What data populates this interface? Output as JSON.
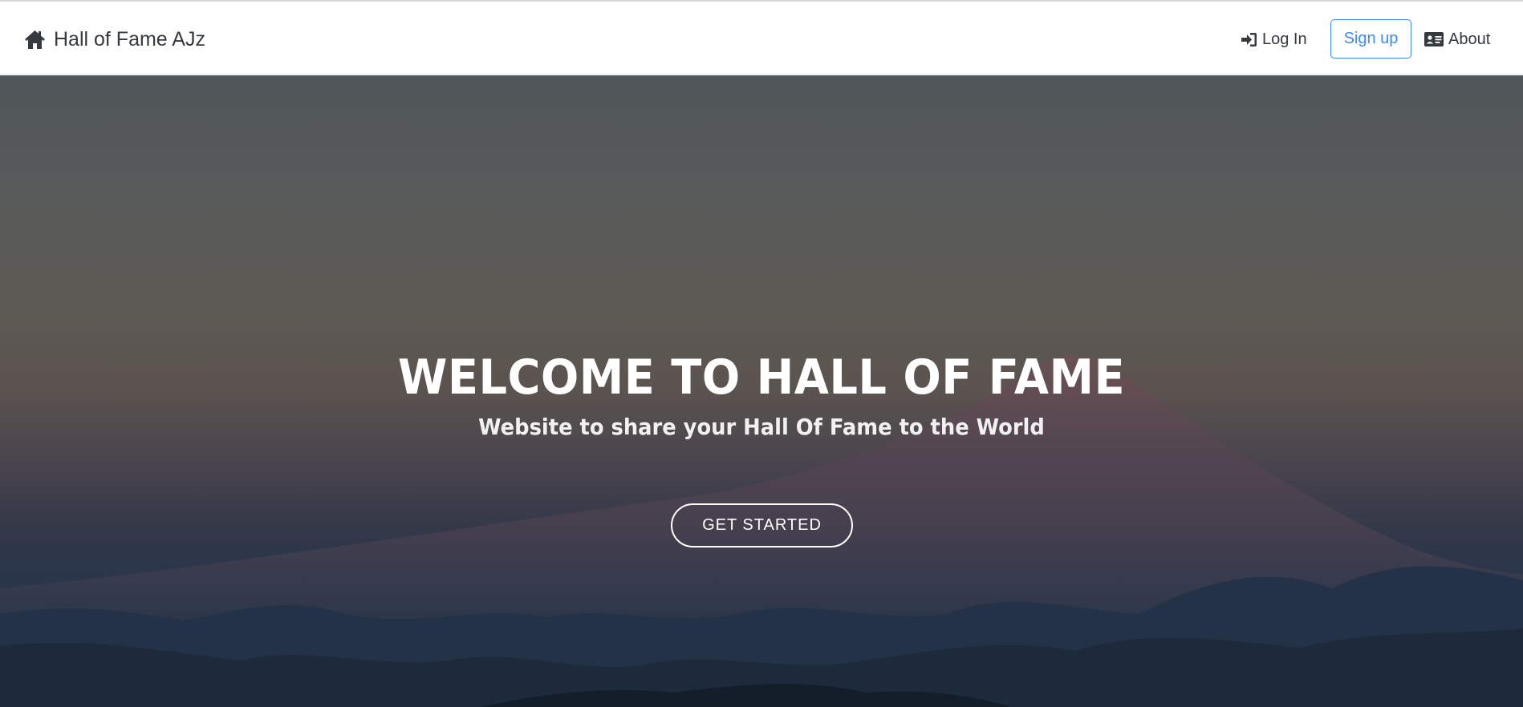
{
  "navbar": {
    "brand_label": "Hall of Fame AJz",
    "brand_icon": "home-icon",
    "login_label": "Log In",
    "login_icon": "sign-in-icon",
    "signup_label": "Sign up",
    "about_label": "About",
    "about_icon": "id-card-icon"
  },
  "hero": {
    "title": "WELCOME TO HALL OF FAME",
    "subtitle": "Website to share your Hall Of Fame to the World",
    "cta_label": "GET STARTED"
  },
  "colors": {
    "accent": "#3d8af7",
    "nav_text": "#343a40",
    "hero_text": "#ffffff"
  }
}
